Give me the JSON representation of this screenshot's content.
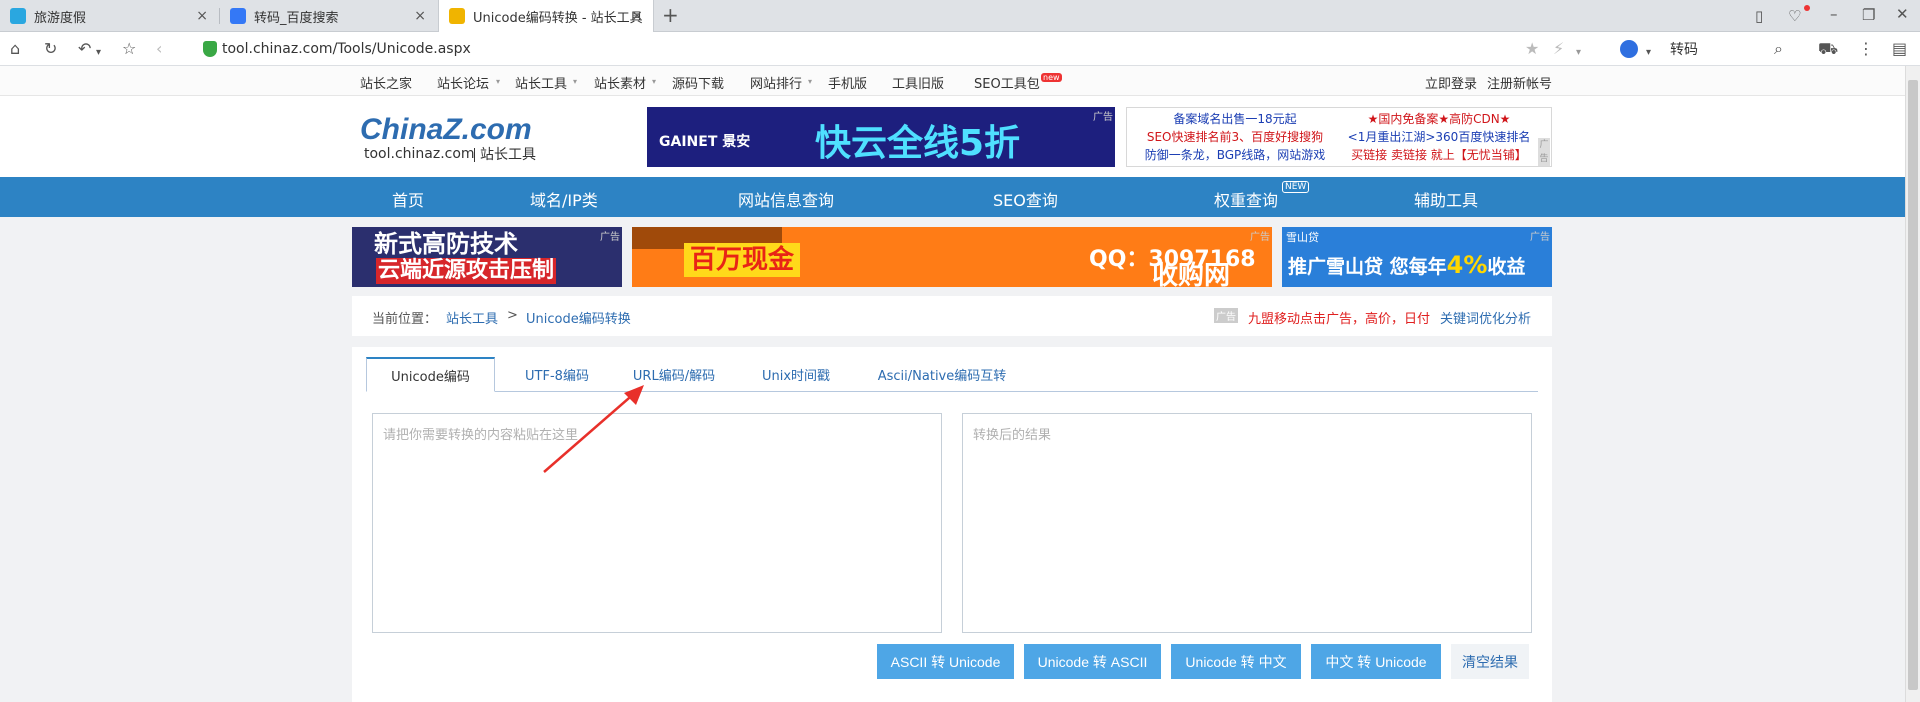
{
  "browser": {
    "tabs": [
      {
        "title": "旅游度假",
        "close": "×"
      },
      {
        "title": "转码_百度搜索",
        "close": "×"
      },
      {
        "title": "Unicode编码转换 - 站长工具",
        "close": "×"
      }
    ],
    "new_tab": "+",
    "address": "tool.chinaz.com/Tools/Unicode.aspx",
    "search_text": "转码",
    "icons": [
      "home-icon",
      "refresh-icon",
      "undo-icon",
      "star-icon",
      "back-icon",
      "secure-icon",
      "cart-icon",
      "menu-icon",
      "search-icon",
      "paw-icon"
    ]
  },
  "topstrip": {
    "links": [
      "站长之家",
      "站长论坛",
      "站长工具",
      "站长素材",
      "源码下载",
      "网站排行",
      "手机版",
      "工具旧版",
      "SEO工具包"
    ],
    "new_badge": "new",
    "login": "立即登录",
    "register": "注册新帐号"
  },
  "header": {
    "logo_main": "ChinaZ.com",
    "logo_sub": "tool.chinaz.com",
    "logo_tag": "站长工具",
    "ad1_brand": "GAINET 景安",
    "ad1_text": "快云全线5折",
    "ad_tag": "广告",
    "text_ads_left": [
      "备案域名出售一18元起",
      "SEO快速排名前3、百度好搜搜狗",
      "防御一条龙，BGP线路，网站游戏"
    ],
    "text_ads_right": [
      "★国内免备案★高防CDN★",
      "<1月重出江湖>360百度快速排名",
      "买链接 卖链接 就上【无忧当铺】"
    ]
  },
  "nav": {
    "items": [
      "首页",
      "域名/IP类",
      "网站信息查询",
      "SEO查询",
      "权重查询",
      "辅助工具"
    ],
    "new_badge": "NEW"
  },
  "banners": {
    "b1": [
      "新式高防技术",
      "云端近源攻击压制"
    ],
    "b2_left": "百万现金",
    "b2_qq": "QQ：3097168",
    "b2_right": "收购网站、",
    "b3_logo": "雪山贷",
    "b3_text": "推广雪山贷 您每年",
    "b3_pct": "4%",
    "b3_suffix": "收益"
  },
  "breadcrumb": {
    "label": "当前位置：",
    "link1": "站长工具",
    "sep": ">",
    "link2": "Unicode编码转换",
    "ad_badge": "广告",
    "ad_text": "九盟移动点击广告，高价，日付",
    "ad_link": "关键词优化分析"
  },
  "tool": {
    "tabs": [
      "Unicode编码",
      "UTF-8编码",
      "URL编码/解码",
      "Unix时间戳",
      "Ascii/Native编码互转"
    ],
    "input_placeholder": "请把你需要转换的内容粘贴在这里",
    "output_placeholder": "转换后的结果",
    "buttons": [
      "ASCII 转 Unicode",
      "Unicode 转 ASCII",
      "Unicode 转 中文",
      "中文 转 Unicode",
      "清空结果"
    ]
  }
}
